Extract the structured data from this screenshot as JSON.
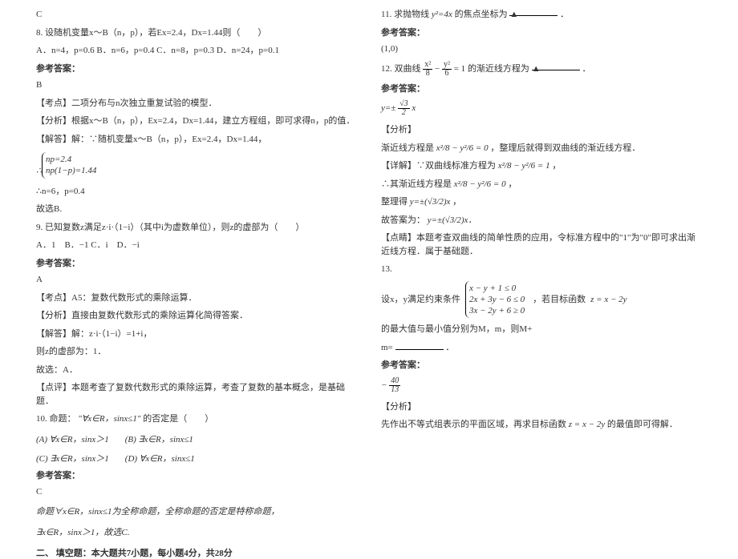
{
  "left": {
    "prefix_c": "C",
    "q8": {
      "text": "8. 设随机变量x～B（n，p），若Ex=2.4，Dx=1.44则（　　）",
      "opts": "A．n=4，p=0.6 B．n=6，p=0.4 C．n=8，p=0.3 D．n=24，p=0.1",
      "ref_label": "参考答案：",
      "ans": "B",
      "kp": "【考点】二项分布与n次独立重复试验的模型．",
      "fx": "【分析】根据x～B（n，p），Ex=2.4，Dx=1.44，建立方程组，即可求得n，p的值．",
      "jd": "【解答】解：∵随机变量x～B（n，p），Ex=2.4，Dx=1.44，",
      "sys1": "np=2.4",
      "sys2": "np(1−p)=1.44",
      "concl": "∴n=6，p=0.4",
      "pick": "故选B."
    },
    "q9": {
      "text": "9. 已知复数z满足z·i·（1−i）（其中i为虚数单位），则z的虚部为（　　）",
      "opts": "A．1　B．−1 C．i　D．−i",
      "ref_label": "参考答案：",
      "ans": "A",
      "kp": "【考点】A5：复数代数形式的乘除运算．",
      "fx": "【分析】直接由复数代数形式的乘除运算化简得答案．",
      "jd": "【解答】解：z·i·（1−i）=1+i，",
      "res": "则z的虚部为：1．",
      "pick": "故选：A．",
      "dp": "【点评】本题考查了复数代数形式的乘除运算，考查了复数的基本概念，是基础题．"
    },
    "q10": {
      "text_pre": "10. 命题：",
      "quant": "\"∀x∈R，sinx≤1\"",
      "text_post": "的否定是（　　）",
      "optA": "(A) ∀x∈R，sinx＞1",
      "optB": "(B) ∃x∈R，sinx≤1",
      "optC": "(C) ∃x∈R，sinx＞1",
      "optD": "(D) ∀x∈R，sinx≤1",
      "ref_label": "参考答案：",
      "ans": "C",
      "expl1": "命题∀x∈R，sinx≤1为全称命题，全称命题的否定是特称命题，",
      "expl2": "∃x∈R，sinx＞1，故选C."
    },
    "section2": "二、 填空题：本大题共7小题，每小题4分，共28分"
  },
  "right": {
    "q11": {
      "text_pre": "11. 求抛物线",
      "expr": "y²=4x",
      "text_post": "的焦点坐标为",
      "mark": "▲",
      "ref_label": "参考答案：",
      "ans": "(1,0)"
    },
    "q12": {
      "text_pre": "12. 双曲线",
      "frac_a": "x²",
      "frac_b": "8",
      "frac_c": "y²",
      "frac_d": "6",
      "frac_eq": " = 1",
      "text_post": "的渐近线方程为",
      "mark": "▲",
      "ref_label": "参考答案：",
      "ans_pre": "y=±",
      "ans_num": "√3",
      "ans_den": "2",
      "ans_post": "x",
      "fx_label": "【分析】",
      "fx_pre": "渐近线方程是",
      "fx_eq": "x²/8 − y²/6 = 0",
      "fx_post": "，整理后就得到双曲线的渐近线方程．",
      "xj_label": "【详解】∵双曲线标准方程为",
      "xj_eq": "x²/8 − y²/6 = 1",
      "xj_concl_pre": "∴其渐近线方程是",
      "xj_concl_eq": "x²/8 − y²/6 = 0",
      "zl_pre": "整理得",
      "zl_ans": "y=±(√3/2)x",
      "gd_pre": "故答案为：",
      "gd_ans": "y=±(√3/2)x．",
      "ds_label": "【点睛】本题考查双曲线的简单性质的应用，令标准方程中的\"1\"为\"0\"即可求出渐近线方程．属于基础题．"
    },
    "q13": {
      "num": "13.",
      "sys1": "x − y + 1 ≤ 0",
      "sys2": "2x + 3y − 6 ≤ 0",
      "sys3": "3x − 2y + 6 ≥ 0",
      "text_pre": "设x，y满足约束条件",
      "text_mid": "，若目标函数",
      "obj": "z = x − 2y",
      "text_post": "的最大值与最小值分别为M，m，则M+",
      "text_tail": "m=",
      "ref_label": "参考答案：",
      "ans_num": "40",
      "ans_den": "13",
      "ans_neg": "−",
      "fx_label": "【分析】",
      "fx_text_pre": "先作出不等式组表示的平面区域，再求目标函数",
      "fx_obj": "z = x − 2y",
      "fx_text_post": "的最值即可得解．"
    }
  }
}
